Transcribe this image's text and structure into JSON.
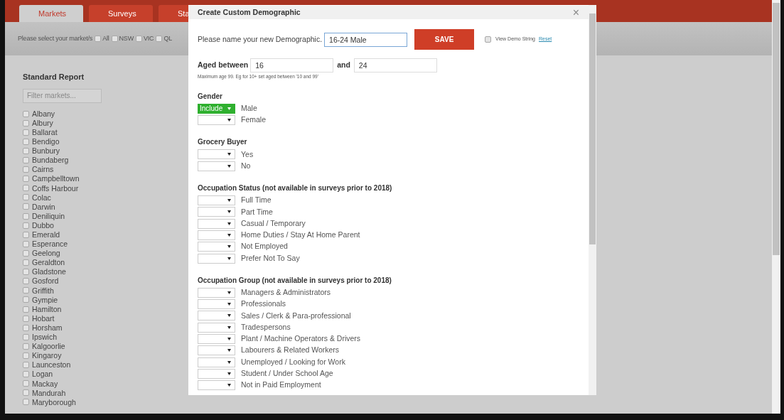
{
  "tabs": [
    {
      "label": "Markets",
      "selected": true
    },
    {
      "label": "Surveys",
      "selected": false
    },
    {
      "label": "Sta",
      "selected": false
    }
  ],
  "market_filter": {
    "prompt": "Please select your market/s",
    "options": [
      {
        "label": "All",
        "checked": false
      },
      {
        "label": "NSW",
        "checked": false
      },
      {
        "label": "VIC",
        "checked": false
      },
      {
        "label": "QL",
        "checked": false
      }
    ]
  },
  "sidebar": {
    "title": "Standard Report",
    "search": {
      "placeholder": "Filter markets..."
    },
    "markets": [
      {
        "label": "Albany",
        "checked": false
      },
      {
        "label": "Albury",
        "checked": false
      },
      {
        "label": "Ballarat",
        "checked": false
      },
      {
        "label": "Bendigo",
        "checked": false
      },
      {
        "label": "Bunbury",
        "checked": false
      },
      {
        "label": "Bundaberg",
        "checked": false
      },
      {
        "label": "Cairns",
        "checked": false
      },
      {
        "label": "Campbelltown",
        "checked": false
      },
      {
        "label": "Coffs Harbour",
        "checked": false
      },
      {
        "label": "Colac",
        "checked": false
      },
      {
        "label": "Darwin",
        "checked": false
      },
      {
        "label": "Deniliquin",
        "checked": false
      },
      {
        "label": "Dubbo",
        "checked": false
      },
      {
        "label": "Emerald",
        "checked": false
      },
      {
        "label": "Esperance",
        "checked": false
      },
      {
        "label": "Geelong",
        "checked": false
      },
      {
        "label": "Geraldton",
        "checked": false
      },
      {
        "label": "Gladstone",
        "checked": false
      },
      {
        "label": "Gosford",
        "checked": false
      },
      {
        "label": "Griffith",
        "checked": false
      },
      {
        "label": "Gympie",
        "checked": false
      },
      {
        "label": "Hamilton",
        "checked": false
      },
      {
        "label": "Hobart",
        "checked": false
      },
      {
        "label": "Horsham",
        "checked": false
      },
      {
        "label": "Ipswich",
        "checked": false
      },
      {
        "label": "Kalgoorlie",
        "checked": false
      },
      {
        "label": "Kingaroy",
        "checked": false
      },
      {
        "label": "Launceston",
        "checked": false
      },
      {
        "label": "Logan",
        "checked": false
      },
      {
        "label": "Mackay",
        "checked": false
      },
      {
        "label": "Mandurah",
        "checked": false
      },
      {
        "label": "Maryborough",
        "checked": false
      }
    ]
  },
  "dialog": {
    "title": "Create Custom Demographic",
    "close": "×",
    "name_prompt": "Please name your new Demographic.",
    "name_value": "16-24 Male",
    "save": "SAVE",
    "view_demo_string": {
      "label": "View Demo String",
      "checked": false
    },
    "reset": "Reset",
    "age": {
      "label": "Aged between",
      "from": "16",
      "and": "and",
      "to": "24",
      "hint": "Maximum age 99. Eg for 10+ set aged between '10 and 99'"
    },
    "sections": [
      {
        "title": "Gender",
        "options": [
          {
            "label": "Male",
            "value": "Include"
          },
          {
            "label": "Female"
          }
        ]
      },
      {
        "title": "Grocery Buyer",
        "options": [
          {
            "label": "Yes"
          },
          {
            "label": "No"
          }
        ]
      },
      {
        "title": "Occupation Status (not available in surveys prior to 2018)",
        "options": [
          {
            "label": "Full Time"
          },
          {
            "label": "Part Time"
          },
          {
            "label": "Casual / Temporary"
          },
          {
            "label": "Home Duties / Stay At Home Parent"
          },
          {
            "label": "Not Employed"
          },
          {
            "label": "Prefer Not To Say"
          }
        ]
      },
      {
        "title": "Occupation Group (not available in surveys prior to 2018)",
        "options": [
          {
            "label": "Managers & Administrators"
          },
          {
            "label": "Professionals"
          },
          {
            "label": "Sales / Clerk & Para-professional"
          },
          {
            "label": "Tradespersons"
          },
          {
            "label": "Plant / Machine Operators & Drivers"
          },
          {
            "label": "Labourers & Related Workers"
          },
          {
            "label": "Unemployed / Looking for Work"
          },
          {
            "label": "Student / Under School Age"
          },
          {
            "label": "Not in Paid Employment"
          }
        ]
      }
    ]
  }
}
